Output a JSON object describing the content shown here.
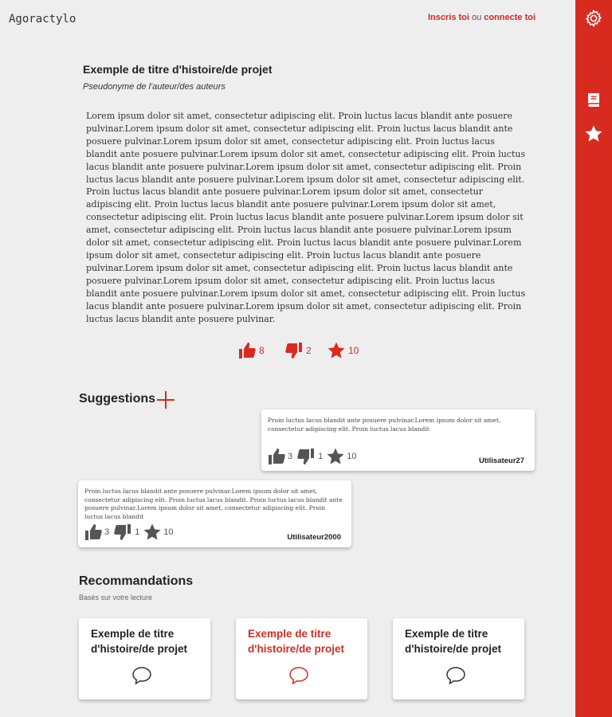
{
  "header": {
    "logo": "Agoractylo",
    "signup_label": "Inscris toi",
    "separator": "ou",
    "login_label": "connecte toi"
  },
  "sidebar": {
    "icons": [
      "gear-icon",
      "book-icon",
      "star-icon"
    ],
    "color": "#d82b20"
  },
  "story": {
    "title": "Exemple de titre d'histoire/de projet",
    "author": "Pseudonyme de l'auteur/des auteurs",
    "body": "Lorem ipsum dolor sit amet, consectetur adipiscing elit. Proin luctus lacus blandit ante posuere pulvinar.Lorem ipsum dolor sit amet, consectetur adipiscing elit. Proin luctus lacus blandit ante posuere pulvinar.Lorem ipsum dolor sit amet, consectetur adipiscing elit. Proin luctus lacus blandit ante posuere pulvinar.Lorem ipsum dolor sit amet, consectetur adipiscing elit. Proin luctus lacus blandit ante posuere pulvinar.Lorem ipsum dolor sit amet, consectetur adipiscing elit. Proin luctus lacus blandit ante posuere pulvinar.Lorem ipsum dolor sit amet, consectetur adipiscing elit. Proin luctus lacus blandit ante posuere pulvinar.Lorem ipsum dolor sit amet, consectetur adipiscing elit. Proin luctus lacus blandit ante posuere pulvinar.Lorem ipsum dolor sit amet, consectetur adipiscing elit. Proin luctus lacus blandit ante posuere pulvinar.Lorem ipsum dolor sit amet, consectetur adipiscing elit. Proin luctus lacus blandit ante posuere pulvinar.Lorem ipsum dolor sit amet, consectetur adipiscing elit. Proin luctus lacus blandit ante posuere pulvinar.Lorem ipsum dolor sit amet, consectetur adipiscing elit. Proin luctus lacus blandit ante posuere pulvinar.Lorem ipsum dolor sit amet, consectetur adipiscing elit. Proin luctus lacus blandit ante posuere pulvinar.Lorem ipsum dolor sit amet, consectetur adipiscing elit. Proin luctus lacus blandit ante posuere pulvinar.Lorem ipsum dolor sit amet, consectetur adipiscing elit. Proin luctus lacus blandit ante posuere pulvinar.Lorem ipsum dolor sit amet, consectetur adipiscing elit. Proin luctus lacus blandit ante posuere pulvinar.",
    "likes": "8",
    "dislikes": "2",
    "stars": "10"
  },
  "suggestions": {
    "title": "Suggestions",
    "items": [
      {
        "text": "Proin luctus lacus blandit ante posuere pulvinar.Lorem ipsum dolor sit amet, consectetur adipiscing elit. Proin luctus lacus blandit",
        "likes": "3",
        "dislikes": "1",
        "stars": "10",
        "user": "Utilisateur27"
      },
      {
        "text": "Proin luctus lacus blandit ante posuere pulvinar.Lorem ipsum dolor sit amet, consectetur adipiscing elit. Proin luctus lacus blandit. Proin luctus lacus blandit ante posuere pulvinar.Lorem ipsum dolor sit amet, consectetur adipiscing elit. Proin luctus lacus blandit",
        "likes": "3",
        "dislikes": "1",
        "stars": "10",
        "user": "Utilisateur2000"
      }
    ]
  },
  "recommendations": {
    "title": "Recommandations",
    "subtitle": "Basés sur votre lecture",
    "items": [
      {
        "title": "Exemple de titre d'histoire/de projet"
      },
      {
        "title": "Exemple de titre d'histoire/de projet",
        "active": true
      },
      {
        "title": "Exemple de titre d'histoire/de projet"
      }
    ]
  },
  "colors": {
    "accent": "#d82b20",
    "background": "#eeeeee",
    "icon_gray": "#555555"
  }
}
